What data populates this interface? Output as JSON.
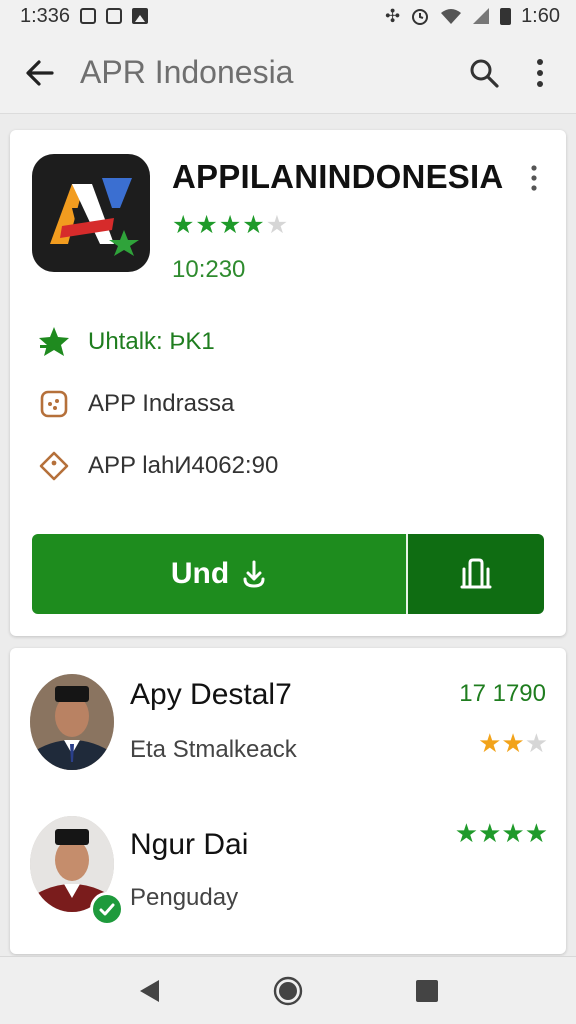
{
  "status_bar": {
    "time_left": "1:336",
    "time_right": "1:60",
    "icons_left": [
      "notification-square-icon",
      "notification-square-icon",
      "image-icon"
    ],
    "icons_right": [
      "signal-glyph-icon",
      "alarm-icon",
      "wifi-icon",
      "cell-signal-icon",
      "battery-icon"
    ]
  },
  "app_bar": {
    "title": "APR Indonesia",
    "icons": [
      "back-arrow-icon",
      "search-icon",
      "more-vert-icon"
    ]
  },
  "app": {
    "name": "APPILANINDONESIA",
    "rating": 4,
    "rating_max": 5,
    "count": "10:230",
    "details": [
      {
        "icon": "star-badge-icon",
        "text": "Uhtalk: ÞK1"
      },
      {
        "icon": "dice-icon",
        "text": "APP Indrassa"
      },
      {
        "icon": "tag-diamond-icon",
        "text": "APP lahИ4062:90"
      }
    ],
    "install_label": "Und",
    "install_icon": "download-icon",
    "share_icon": "share-phone-icon"
  },
  "reviews": [
    {
      "name": "Apy Destal7",
      "text": "Eta Stmalkeack",
      "count": "17 1790",
      "rating": 2,
      "rating_max": 3,
      "star_color": "#f2a31a"
    },
    {
      "name": "Ngur Dai",
      "text": "Penguday",
      "count": "",
      "rating": 4,
      "rating_max": 4,
      "star_color": "#1f9a2a"
    }
  ],
  "nav": {
    "icons": [
      "back-triangle-icon",
      "home-circle-icon",
      "recents-square-icon"
    ]
  },
  "colors": {
    "primary_green": "#1e8c1e",
    "dark_green": "#0f6d12",
    "star_green": "#1f9a2a",
    "star_gold": "#f2a31a"
  }
}
